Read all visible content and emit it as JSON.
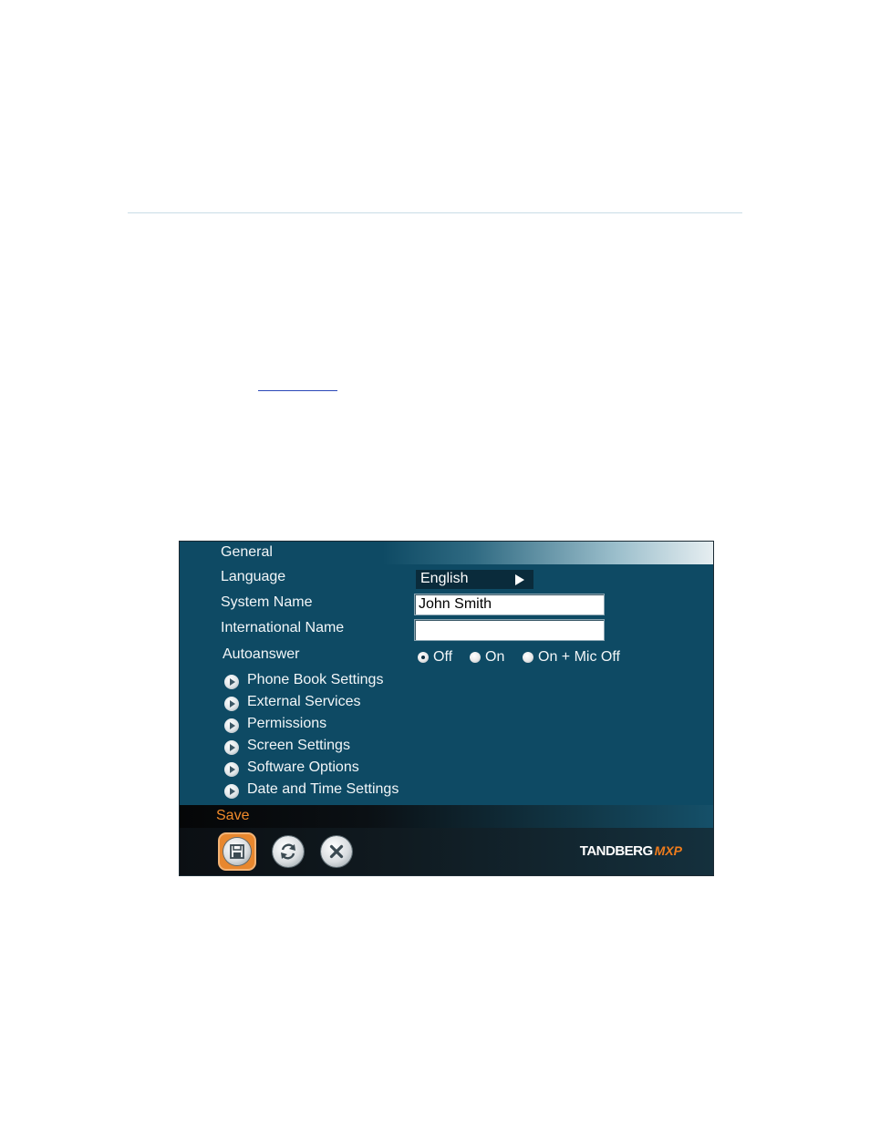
{
  "panel": {
    "title": "General",
    "language": {
      "label": "Language",
      "value": "English"
    },
    "system_name": {
      "label": "System Name",
      "value": "John Smith"
    },
    "international_name": {
      "label": "International Name",
      "value": ""
    },
    "autoanswer": {
      "label": "Autoanswer",
      "options": [
        "Off",
        "On",
        "On + Mic Off"
      ],
      "selected": "Off"
    },
    "menu_items": [
      "Phone Book Settings",
      "External Services",
      "Permissions",
      "Screen Settings",
      "Software Options",
      "Date and Time Settings"
    ],
    "action_label": "Save",
    "brand": {
      "name": "TANDBERG",
      "model": "MXP"
    },
    "colors": {
      "panel_bg": "#0e4a64",
      "accent": "#e8872e",
      "save_label": "#f08a2a"
    },
    "icons": [
      "menu-arrow-icon",
      "save-floppy-icon",
      "refresh-icon",
      "close-icon"
    ]
  }
}
